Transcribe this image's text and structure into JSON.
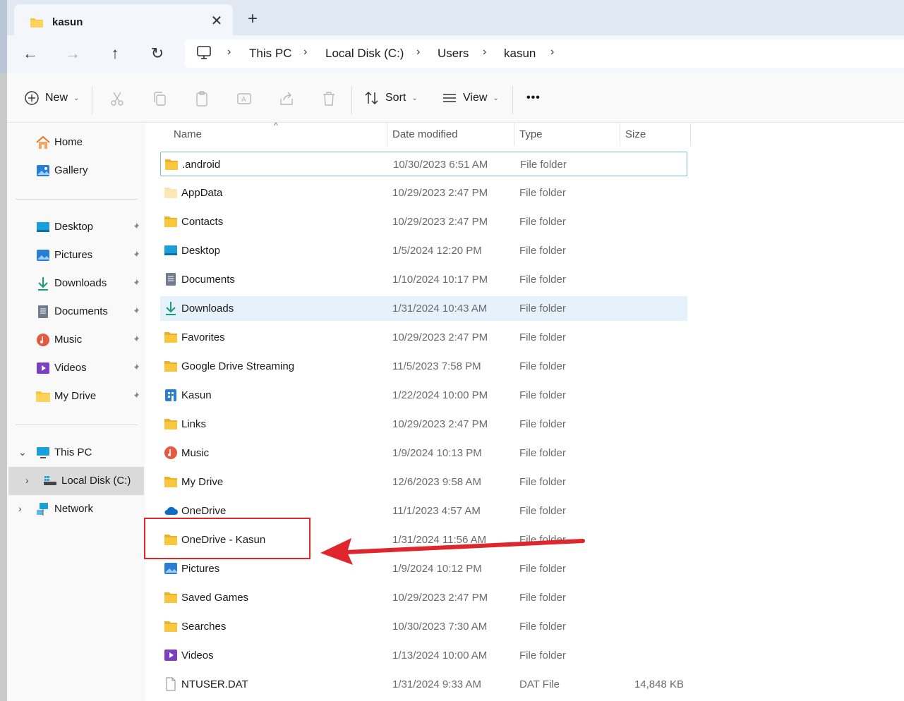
{
  "window": {
    "tab_title": "kasun",
    "tab_close": "✕",
    "new_tab": "+"
  },
  "nav": {
    "back": "←",
    "forward": "→",
    "up": "↑",
    "refresh": "↻",
    "breadcrumbs": [
      "This PC",
      "Local Disk (C:)",
      "Users",
      "kasun"
    ],
    "chevron": "›"
  },
  "toolbar": {
    "new_label": "New",
    "sort_label": "Sort",
    "view_label": "View",
    "more_label": "•••",
    "caret": "⌄"
  },
  "sidebar": {
    "quick": [
      {
        "label": "Home",
        "icon": "home-icon"
      },
      {
        "label": "Gallery",
        "icon": "gallery-icon"
      }
    ],
    "pinned": [
      {
        "label": "Desktop",
        "icon": "desktop-icon"
      },
      {
        "label": "Pictures",
        "icon": "pictures-icon"
      },
      {
        "label": "Downloads",
        "icon": "downloads-icon"
      },
      {
        "label": "Documents",
        "icon": "documents-icon"
      },
      {
        "label": "Music",
        "icon": "music-icon"
      },
      {
        "label": "Videos",
        "icon": "videos-icon"
      },
      {
        "label": "My Drive",
        "icon": "folder-icon"
      }
    ],
    "tree": [
      {
        "label": "This PC",
        "expander": "⌄"
      },
      {
        "label": "Local Disk (C:)",
        "expander": "›"
      },
      {
        "label": "Network",
        "expander": "›"
      }
    ]
  },
  "columns": {
    "name": "Name",
    "date": "Date modified",
    "type": "Type",
    "size": "Size",
    "sort_indicator": "^"
  },
  "files": [
    {
      "name": ".android",
      "date": "10/30/2023 6:51 AM",
      "type": "File folder",
      "size": "",
      "icon": "folder-icon"
    },
    {
      "name": "AppData",
      "date": "10/29/2023 2:47 PM",
      "type": "File folder",
      "size": "",
      "icon": "folder-hidden-icon"
    },
    {
      "name": "Contacts",
      "date": "10/29/2023 2:47 PM",
      "type": "File folder",
      "size": "",
      "icon": "folder-icon"
    },
    {
      "name": "Desktop",
      "date": "1/5/2024 12:20 PM",
      "type": "File folder",
      "size": "",
      "icon": "desktop-icon"
    },
    {
      "name": "Documents",
      "date": "1/10/2024 10:17 PM",
      "type": "File folder",
      "size": "",
      "icon": "documents-icon"
    },
    {
      "name": "Downloads",
      "date": "1/31/2024 10:43 AM",
      "type": "File folder",
      "size": "",
      "icon": "downloads-icon"
    },
    {
      "name": "Favorites",
      "date": "10/29/2023 2:47 PM",
      "type": "File folder",
      "size": "",
      "icon": "folder-icon"
    },
    {
      "name": "Google Drive Streaming",
      "date": "11/5/2023 7:58 PM",
      "type": "File folder",
      "size": "",
      "icon": "folder-icon"
    },
    {
      "name": "Kasun",
      "date": "1/22/2024 10:00 PM",
      "type": "File folder",
      "size": "",
      "icon": "building-icon"
    },
    {
      "name": "Links",
      "date": "10/29/2023 2:47 PM",
      "type": "File folder",
      "size": "",
      "icon": "folder-icon"
    },
    {
      "name": "Music",
      "date": "1/9/2024 10:13 PM",
      "type": "File folder",
      "size": "",
      "icon": "music-icon"
    },
    {
      "name": "My Drive",
      "date": "12/6/2023 9:58 AM",
      "type": "File folder",
      "size": "",
      "icon": "folder-icon"
    },
    {
      "name": "OneDrive",
      "date": "11/1/2023 4:57 AM",
      "type": "File folder",
      "size": "",
      "icon": "cloud-icon"
    },
    {
      "name": "OneDrive - Kasun",
      "date": "1/31/2024 11:56 AM",
      "type": "File folder",
      "size": "",
      "icon": "folder-icon"
    },
    {
      "name": "Pictures",
      "date": "1/9/2024 10:12 PM",
      "type": "File folder",
      "size": "",
      "icon": "pictures-icon"
    },
    {
      "name": "Saved Games",
      "date": "10/29/2023 2:47 PM",
      "type": "File folder",
      "size": "",
      "icon": "folder-icon"
    },
    {
      "name": "Searches",
      "date": "10/30/2023 7:30 AM",
      "type": "File folder",
      "size": "",
      "icon": "folder-icon"
    },
    {
      "name": "Videos",
      "date": "1/13/2024 10:00 AM",
      "type": "File folder",
      "size": "",
      "icon": "videos-icon"
    },
    {
      "name": "NTUSER.DAT",
      "date": "1/31/2024 9:33 AM",
      "type": "DAT File",
      "size": "14,848 KB",
      "icon": "file-icon"
    }
  ],
  "colors": {
    "accent": "#0067c0",
    "folder": "#f8c73d",
    "selection": "#e5f1fb",
    "annotation": "#e0262d"
  }
}
